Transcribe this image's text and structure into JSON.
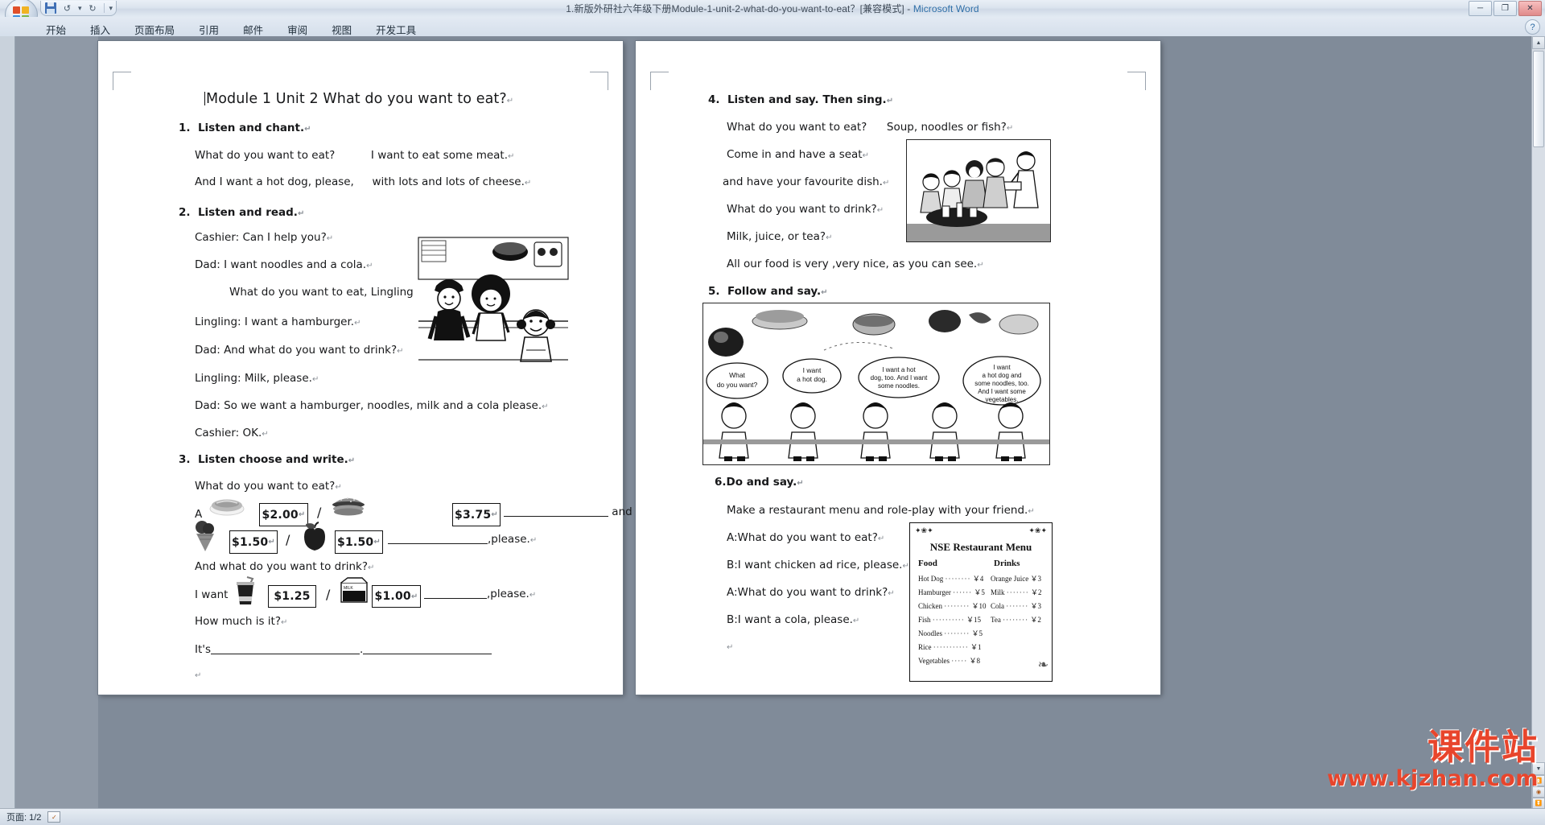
{
  "window": {
    "title": "1.新版外研社六年级下册Module-1-unit-2-what-do-you-want-to-eat？[兼容模式]",
    "separator": " - ",
    "app_name": "Microsoft Word",
    "minimize": "─",
    "maximize": "❐",
    "close": "✕"
  },
  "quick_access": {
    "save_icon": "save-icon",
    "undo": "↺",
    "undo_dropdown": "▾",
    "redo": "↻",
    "customize": "▾"
  },
  "ribbon": {
    "tabs": [
      {
        "label": "开始"
      },
      {
        "label": "插入"
      },
      {
        "label": "页面布局"
      },
      {
        "label": "引用"
      },
      {
        "label": "邮件"
      },
      {
        "label": "审阅"
      },
      {
        "label": "视图"
      },
      {
        "label": "开发工具"
      }
    ],
    "help_label": "?"
  },
  "scrollbar": {
    "up": "▲",
    "down": "▼",
    "prev_page": "⏫",
    "select_object": "◉",
    "next_page": "⏬"
  },
  "status_bar": {
    "page_label": "页面: 1/2",
    "proof_icon": "proofing-icon"
  },
  "watermark": {
    "line1": "课件站",
    "line2": "www.kjzhan.com"
  },
  "page_left": {
    "title": "Module 1    Unit 2    What do you want to eat?",
    "title_mark": "↵",
    "sections": [
      {
        "number": "1.",
        "heading": "Listen and chant.",
        "mark": "↵",
        "lines": [
          {
            "text": "What do you want to eat?",
            "text2": "I want to eat some meat.",
            "mark": "↵"
          },
          {
            "text": "And I want a hot dog, please,",
            "text2": "with lots and lots of cheese.",
            "mark": "↵"
          }
        ]
      },
      {
        "number": "2.",
        "heading": "Listen and read.",
        "mark": "↵",
        "lines": [
          {
            "text": "Cashier:    Can I help you?",
            "mark": "↵"
          },
          {
            "text": "Dad:    I want noodles and a cola.",
            "mark": "↵"
          },
          {
            "text": "What do you want to eat, Lingling?",
            "mark": "↵"
          },
          {
            "text": "Lingling: I want a hamburger.",
            "mark": "↵"
          },
          {
            "text": "Dad: And what do you want to drink?",
            "mark": "↵"
          },
          {
            "text": "Lingling: Milk, please.",
            "mark": "↵"
          },
          {
            "text": "Dad: So we want a hamburger, noodles, milk and a cola please.",
            "mark": "↵"
          },
          {
            "text": "Cashier: OK.",
            "mark": "↵"
          }
        ]
      },
      {
        "number": "3.",
        "heading": "Listen choose and write.",
        "mark": "↵",
        "q1": "What do you want to eat?",
        "q1_mark": "↵",
        "q2": "And what do you want to drink?",
        "q2_mark": "↵",
        "q3": "How much is it?",
        "q3_mark": "↵",
        "answer_prefix": "It's",
        "choice_label_a": "A",
        "i_want_label": "I want",
        "separator": "/",
        "tail_and_an": "and an",
        "tail_and_an_mark": "↵",
        "tail_please1": ",please.",
        "tail_please1_mark": "↵",
        "tail_please2": ",please.",
        "tail_please2_mark": "↵",
        "prices": [
          {
            "item": "hot-dog",
            "value": "$2.00",
            "mark": "↵"
          },
          {
            "item": "hamburger",
            "value": "$3.75",
            "mark": "↵"
          },
          {
            "item": "ice-cream",
            "value": "$1.50",
            "mark": "↵"
          },
          {
            "item": "apple",
            "value": "$1.50",
            "mark": "↵"
          },
          {
            "item": "cola",
            "value": "$1.25",
            "mark": ""
          },
          {
            "item": "milk",
            "value": "$1.00",
            "mark": "↵"
          }
        ],
        "end_mark": "↵"
      }
    ]
  },
  "page_right": {
    "sections": [
      {
        "number": "4.",
        "heading": "Listen and say. Then sing.",
        "mark": "↵",
        "lines": [
          {
            "text": "What do you want to eat?",
            "text2": "Soup, noodles or fish?",
            "mark": "↵"
          },
          {
            "text": "Come in and have a seat",
            "mark": "↵"
          },
          {
            "text": "and have your favourite dish.",
            "mark": "↵"
          },
          {
            "text": "What do you want to drink?",
            "mark": "↵"
          },
          {
            "text": "Milk, juice, or tea?",
            "mark": "↵"
          },
          {
            "text": "All our food is very ,very nice, as you can see.",
            "mark": "↵"
          }
        ]
      },
      {
        "number": "5.",
        "heading": "Follow and say.",
        "mark": "↵"
      },
      {
        "number": "6.Do and say.",
        "heading": "",
        "mark": "↵",
        "lines": [
          {
            "text": "Make a restaurant menu and role-play with your friend.",
            "mark": "↵"
          },
          {
            "text": "A:What do you want to eat?",
            "mark": "↵"
          },
          {
            "text": "B:I want chicken ad rice, please.",
            "mark": "↵"
          },
          {
            "text": "A:What do you want to drink?",
            "mark": "↵"
          },
          {
            "text": "B:I want a cola, please.",
            "mark": "↵"
          }
        ],
        "end_mark": "↵"
      }
    ],
    "comic_bubbles": [
      {
        "text": "What do you want?"
      },
      {
        "text": "I want a hot dog."
      },
      {
        "text": "I want a hot dog, too. And I want some noodles."
      },
      {
        "text": "I want a hot dog and some noodles, too. And I want some vegetables."
      }
    ],
    "menu_card": {
      "title": "NSE Restaurant Menu",
      "col_food": "Food",
      "col_drinks": "Drinks",
      "food_items": [
        {
          "name": "Hot Dog",
          "price": "￥4"
        },
        {
          "name": "Hamburger",
          "price": "￥5"
        },
        {
          "name": "Chicken",
          "price": "￥10"
        },
        {
          "name": "Fish",
          "price": "￥15"
        },
        {
          "name": "Noodles",
          "price": "￥5"
        },
        {
          "name": "Rice",
          "price": "￥1"
        },
        {
          "name": "Vegetables",
          "price": "￥8"
        }
      ],
      "drink_items": [
        {
          "name": "Orange Juice",
          "price": "￥3"
        },
        {
          "name": "Milk",
          "price": "￥2"
        },
        {
          "name": "Cola",
          "price": "￥3"
        },
        {
          "name": "Tea",
          "price": "￥2"
        }
      ]
    }
  },
  "colors": {
    "accent": "#2f6fa8",
    "watermark": "#e8452c",
    "page": "#ffffff",
    "desk": "#808b99"
  }
}
